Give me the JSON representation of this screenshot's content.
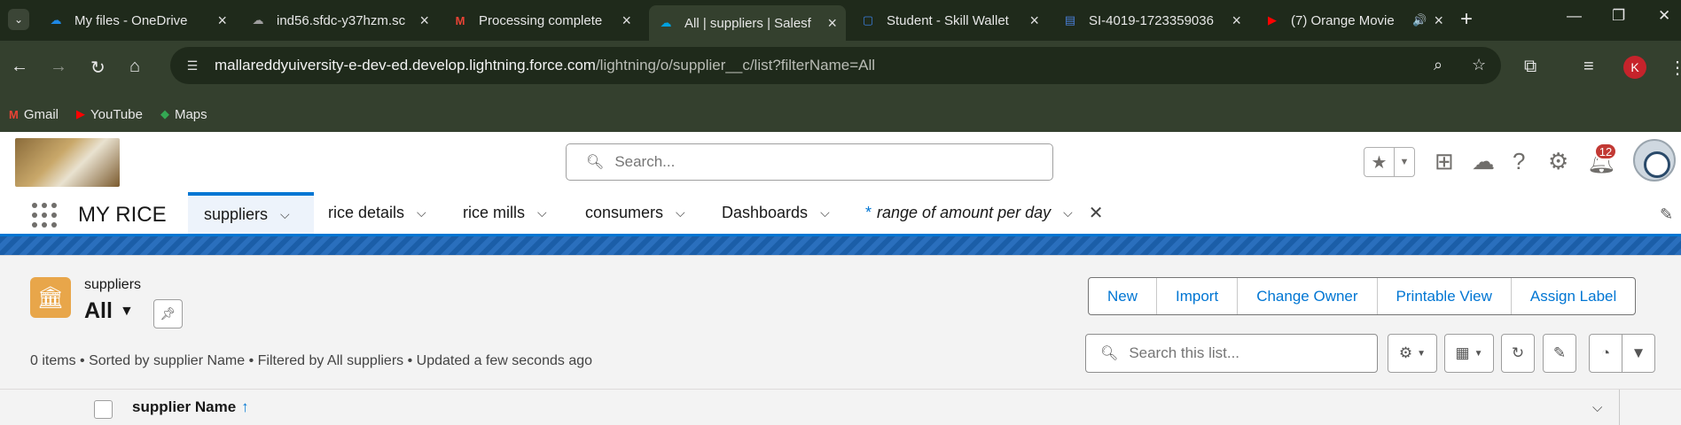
{
  "browser": {
    "tabs": [
      {
        "title": "My files - OneDrive",
        "icon": "onedrive-icon",
        "color": "#1e88e5"
      },
      {
        "title": "ind56.sfdc-y37hzm.sc",
        "icon": "cloud-icon",
        "color": "#9e9e9e"
      },
      {
        "title": "Processing complete",
        "icon": "gmail-icon",
        "color": "#ea4335"
      },
      {
        "title": "All | suppliers | Salesf",
        "icon": "salesforce-icon",
        "color": "#00a1e0",
        "active": true
      },
      {
        "title": "Student - Skill Wallet",
        "icon": "skillwallet-icon",
        "color": "#3b7ddd"
      },
      {
        "title": "SI-4019-1723359036",
        "icon": "document-icon",
        "color": "#4a7fd9"
      },
      {
        "title": "(7) Orange Movie",
        "icon": "youtube-icon",
        "color": "#ff0000"
      }
    ],
    "url_host": "mallareddyuiversity-e-dev-ed.develop.lightning.force.com",
    "url_path": "/lightning/o/supplier__c/list?filterName=All",
    "profile_initial": "K",
    "bookmarks": [
      {
        "label": "Gmail",
        "icon": "gmail-icon"
      },
      {
        "label": "YouTube",
        "icon": "youtube-icon"
      },
      {
        "label": "Maps",
        "icon": "maps-icon"
      }
    ]
  },
  "header": {
    "search_placeholder": "Search...",
    "notification_count": "12"
  },
  "appnav": {
    "app_name": "MY RICE",
    "items": [
      {
        "label": "suppliers",
        "active": true
      },
      {
        "label": "rice details"
      },
      {
        "label": "rice mills"
      },
      {
        "label": "consumers"
      },
      {
        "label": "Dashboards"
      }
    ],
    "temp_tab": {
      "prefix": "*",
      "label": "range of amount per day"
    }
  },
  "listview": {
    "object_label": "suppliers",
    "view_name": "All",
    "buttons": [
      "New",
      "Import",
      "Change Owner",
      "Printable View",
      "Assign Label"
    ],
    "meta": "0 items • Sorted by supplier Name • Filtered by All suppliers • Updated a few seconds ago",
    "search_placeholder": "Search this list...",
    "columns": [
      {
        "label": "supplier Name",
        "sort": "↑"
      }
    ]
  },
  "colors": {
    "accent": "#0176d3",
    "badge": "#c23934",
    "object_icon": "#e8a64a"
  }
}
